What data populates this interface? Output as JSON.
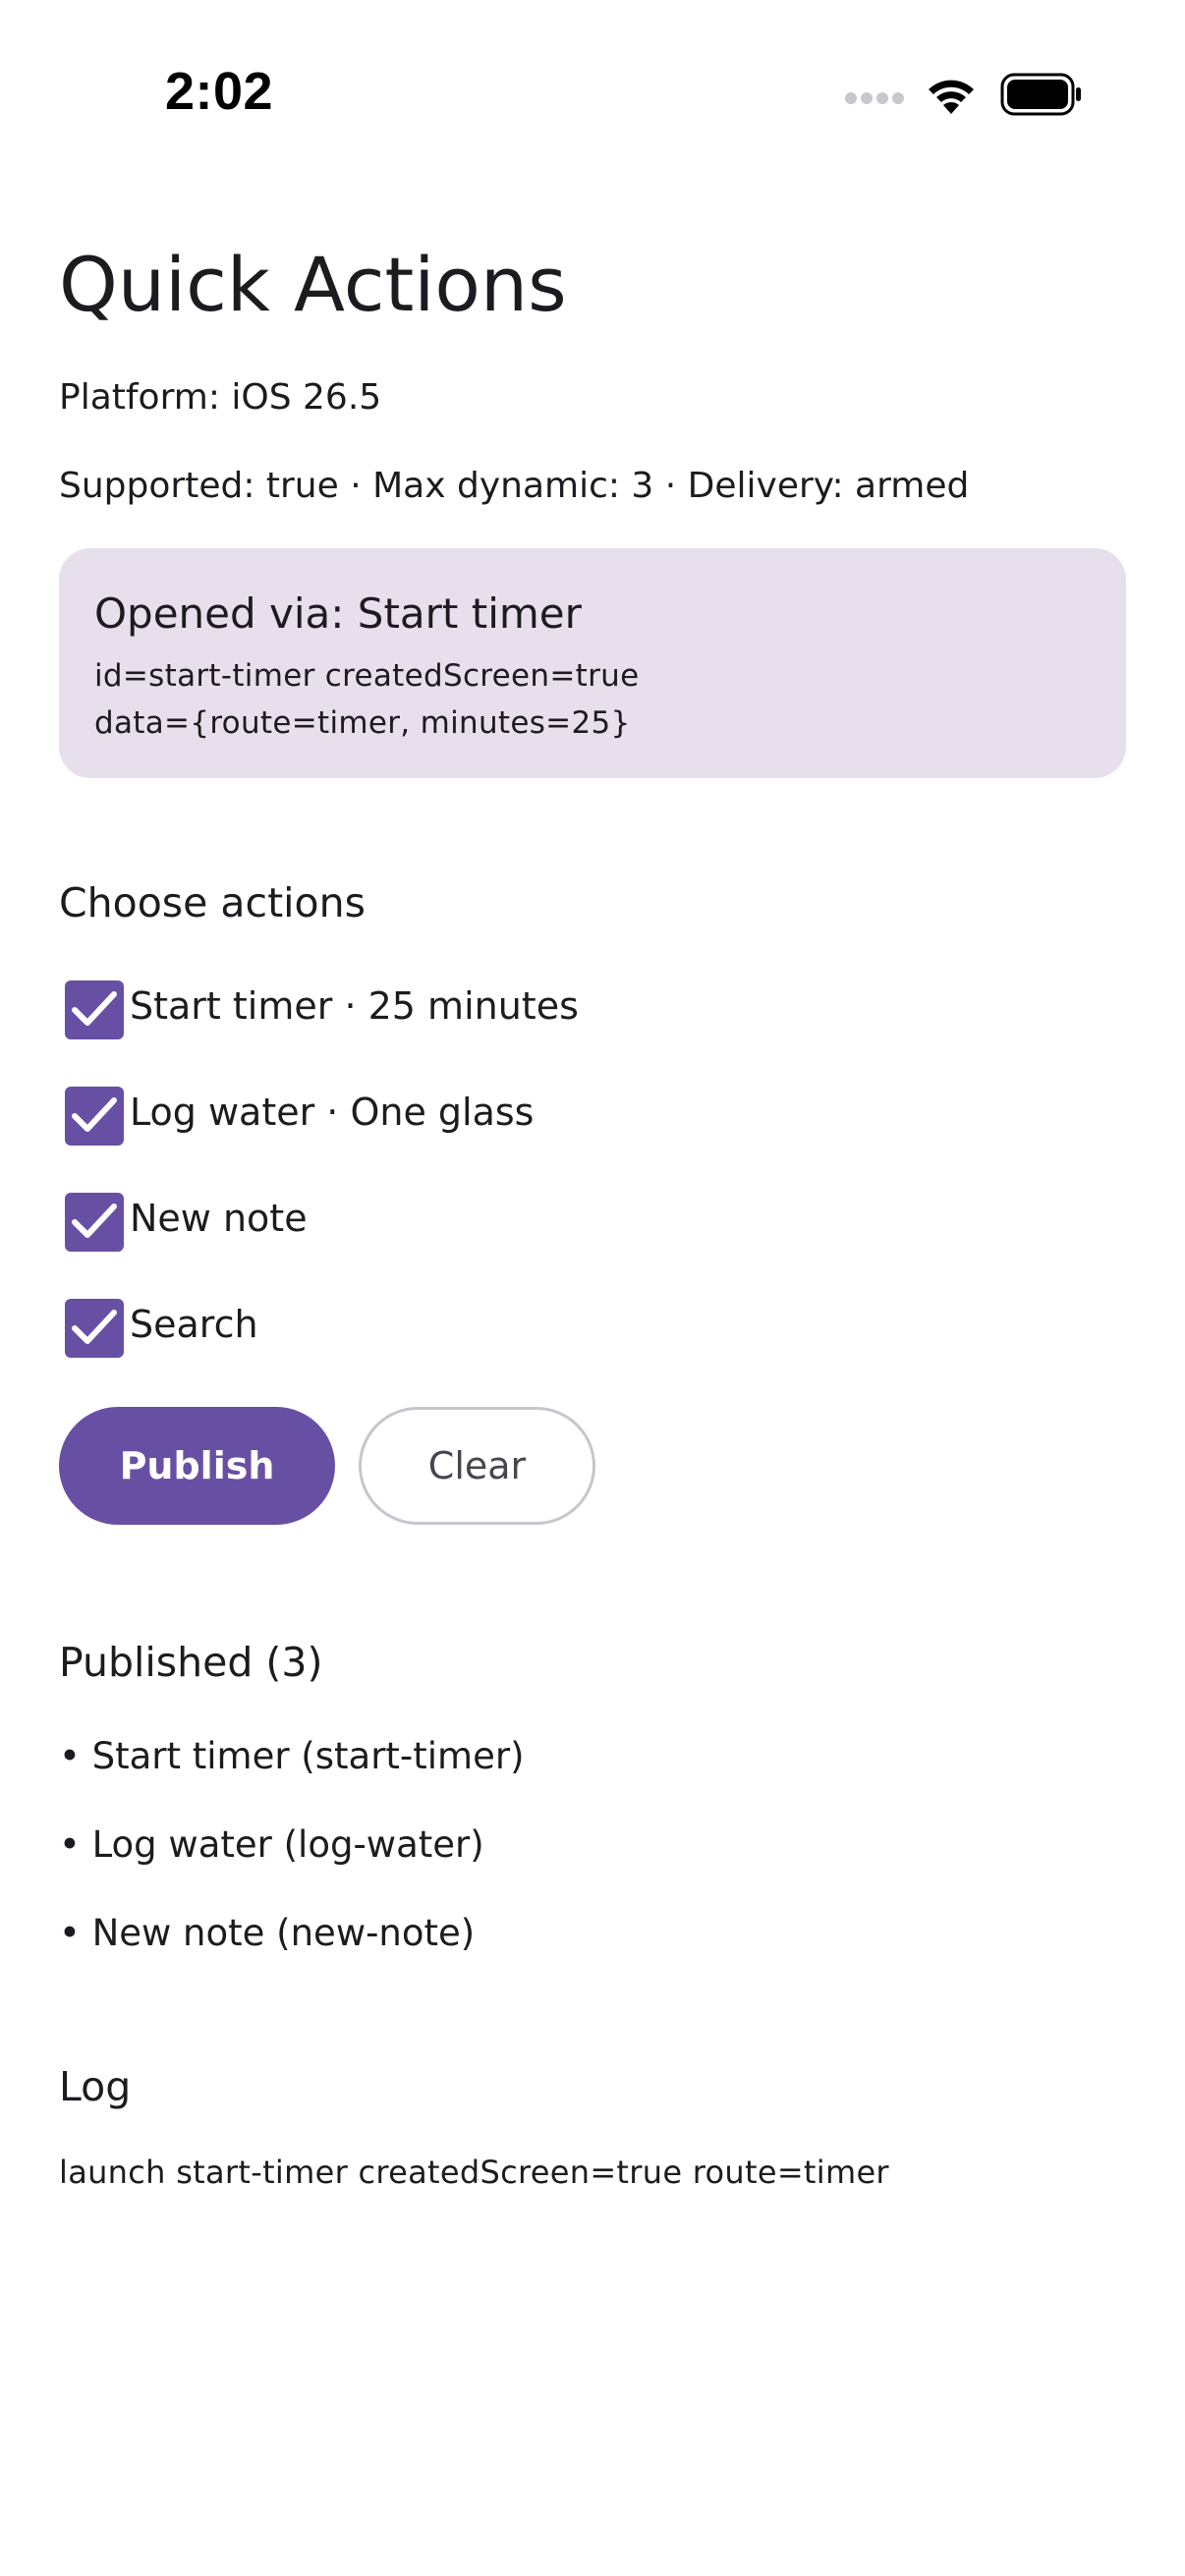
{
  "status_bar": {
    "time": "2:02"
  },
  "header": {
    "title": "Quick Actions",
    "platform": "Platform: iOS 26.5",
    "support_line": "Supported: true · Max dynamic: 3 · Delivery: armed"
  },
  "opened_card": {
    "title": "Opened via: Start timer",
    "line1": "id=start-timer createdScreen=true",
    "line2": "data={route=timer, minutes=25}"
  },
  "choose": {
    "title": "Choose actions",
    "items": [
      {
        "label": "Start timer · 25 minutes",
        "checked": true
      },
      {
        "label": "Log water · One glass",
        "checked": true
      },
      {
        "label": "New note",
        "checked": true
      },
      {
        "label": "Search",
        "checked": true
      }
    ]
  },
  "buttons": {
    "publish": "Publish",
    "clear": "Clear"
  },
  "published": {
    "title": "Published (3)",
    "items": [
      "• Start timer (start-timer)",
      "• Log water (log-water)",
      "• New note (new-note)"
    ]
  },
  "log": {
    "title": "Log",
    "entries": [
      "launch start-timer createdScreen=true route=timer"
    ]
  },
  "colors": {
    "accent": "#6750a4",
    "card_bg": "#e7e0ec",
    "text": "#1d1b20",
    "outline": "#c8c5cc"
  },
  "icons": [
    "cellular-signal-icon",
    "wifi-icon",
    "battery-icon",
    "checkmark-icon"
  ]
}
